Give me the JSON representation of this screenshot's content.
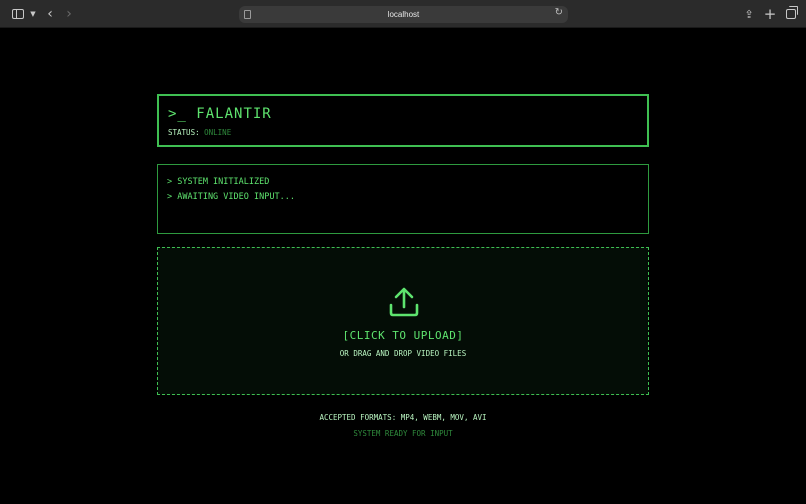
{
  "browser": {
    "url": "localhost",
    "icons": [
      "sidebar-toggle-icon",
      "chevron-down-icon",
      "back-arrow-icon",
      "forward-arrow-icon",
      "site-settings-icon",
      "reload-icon",
      "share-icon",
      "plus-icon",
      "tabs-overview-icon"
    ]
  },
  "app": {
    "prompt": ">_",
    "name": "FALANTIR",
    "status_label": "STATUS:",
    "status_value": "ONLINE"
  },
  "log": {
    "lines": [
      "> SYSTEM INITIALIZED",
      "> AWAITING VIDEO INPUT..."
    ]
  },
  "upload": {
    "icon": "upload-icon",
    "action_label": "[CLICK TO UPLOAD]",
    "drag_hint": "OR DRAG AND DROP VIDEO FILES"
  },
  "footer": {
    "formats": "ACCEPTED FORMATS: MP4, WEBM, MOV, AVI",
    "ready": "SYSTEM READY FOR INPUT"
  },
  "colors": {
    "accent": "#5ee36e",
    "border": "#3fbf52",
    "dim": "#2f8a3c",
    "light": "#b9f5c0",
    "background": "#000000"
  }
}
